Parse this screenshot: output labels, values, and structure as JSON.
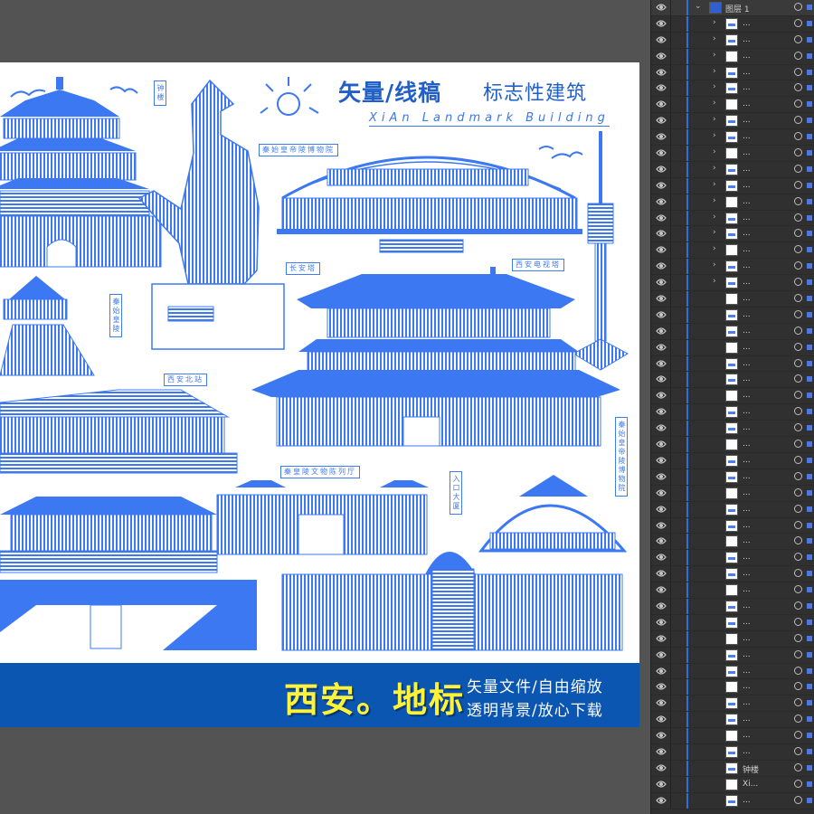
{
  "artboard": {
    "title_main": "矢量/线稿",
    "title_sub": "标志性建筑",
    "title_en": "XiAn Landmark Building",
    "labels": {
      "bell_tower": "钟楼",
      "museum_top": "秦始皇帝陵博物院",
      "museum_right": "秦始皇帝陵博物院",
      "museum_left": "秦始皇陵",
      "changan": "长安塔",
      "tv_tower": "西安电视塔",
      "north_station": "西安北站",
      "exhibition": "秦皇陵文物陈列厅",
      "gate_vertical": "入口大厦"
    },
    "banner": {
      "title": "西安。地标",
      "line1": "矢量文件/自由缩放",
      "line2": "透明背景/放心下载"
    },
    "accent_color": "#3b78f2",
    "banner_color": "#0b56b0",
    "banner_title_color": "#fff33a"
  },
  "layers_panel": {
    "group_name": "图层 1",
    "sub_layer_placeholder": "...",
    "named_layers": [
      "钟楼",
      "Xi..."
    ]
  }
}
